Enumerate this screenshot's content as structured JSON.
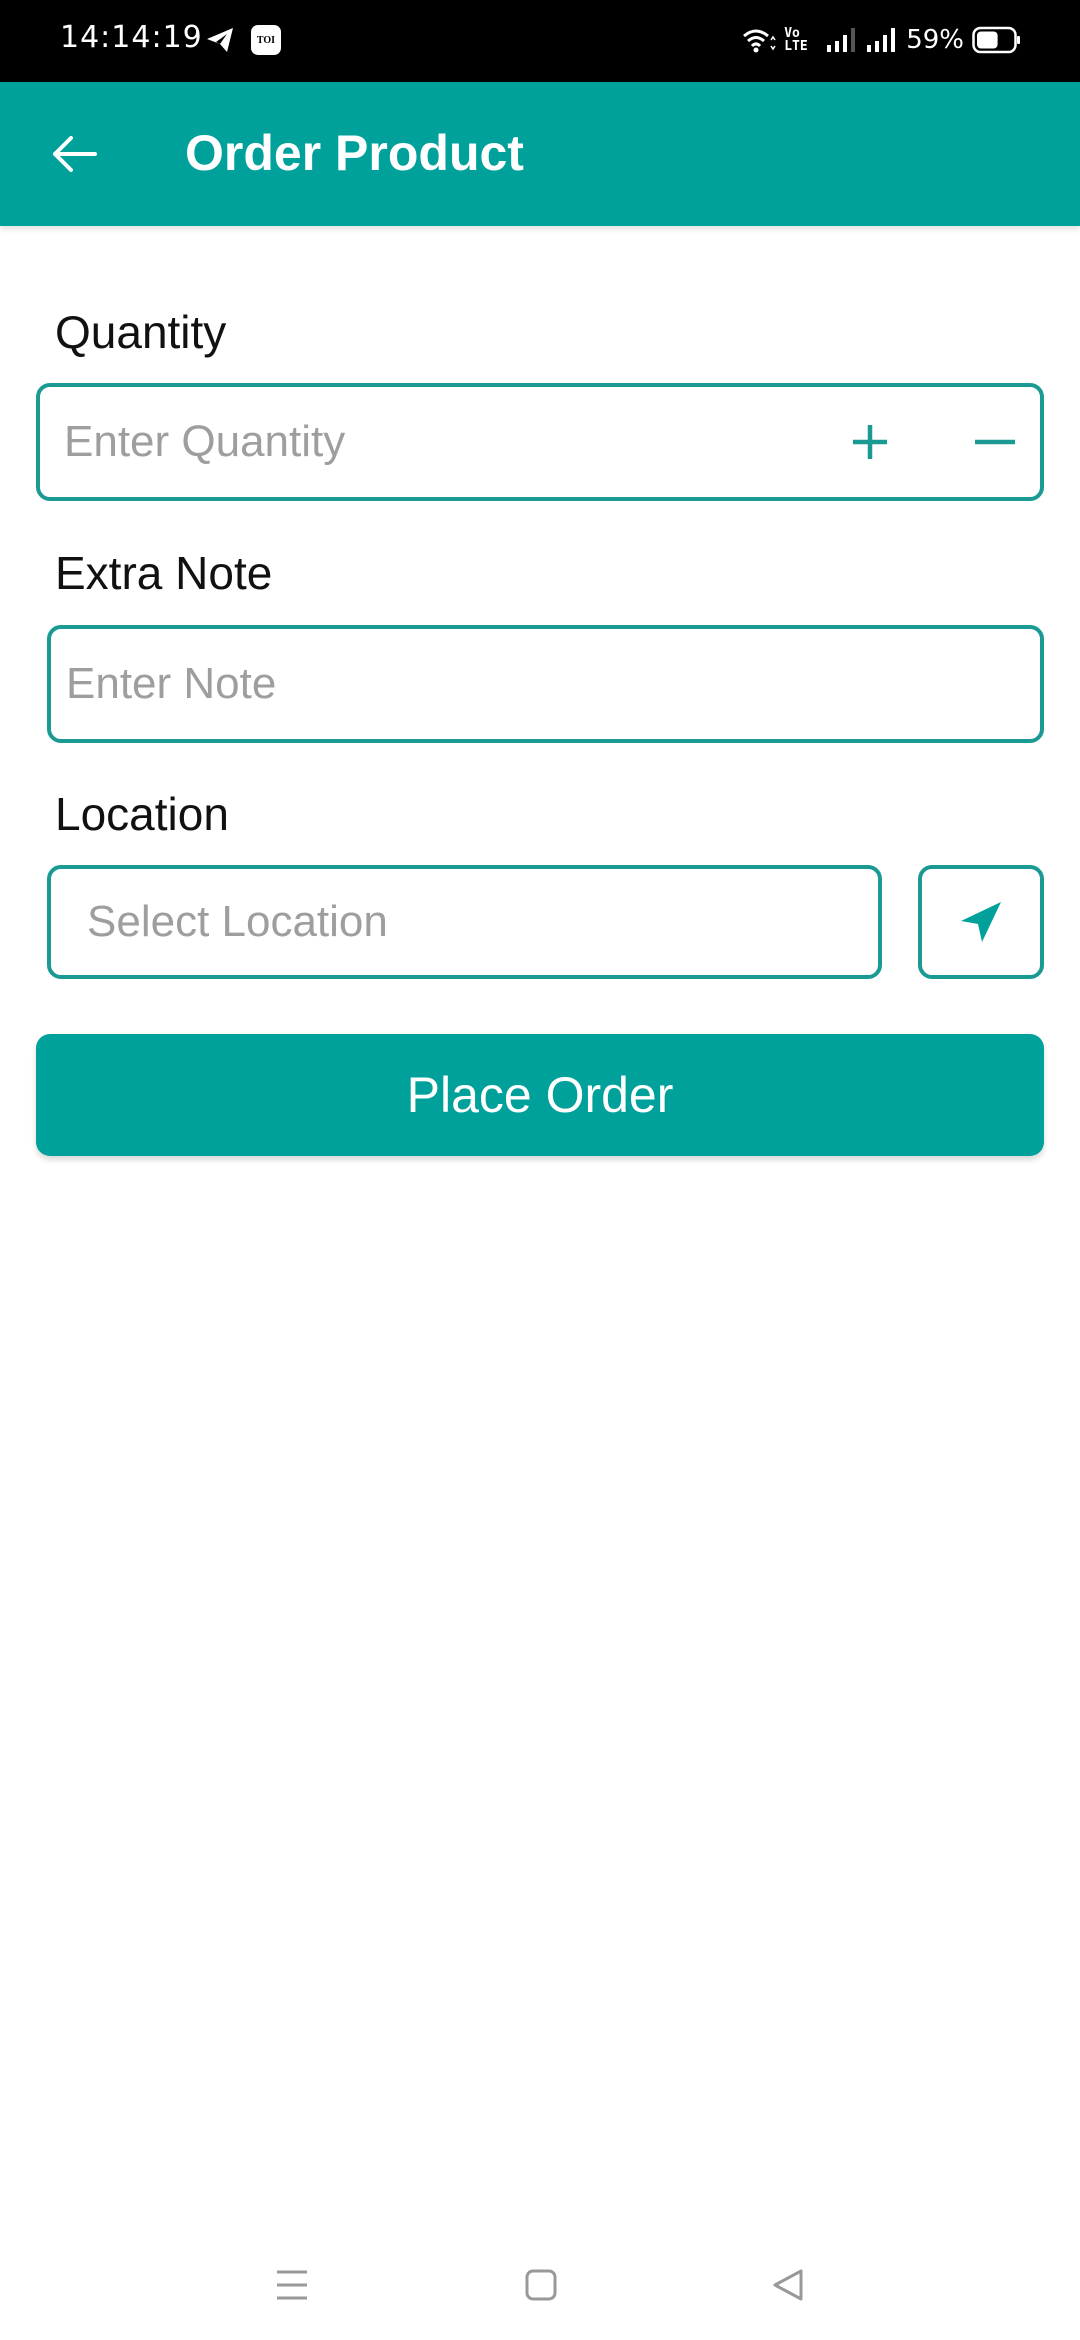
{
  "status_bar": {
    "time": "14:14:19",
    "notification_icons": [
      "telegram-icon",
      "toi-icon"
    ],
    "toi_label": "TOI",
    "volte_label_top": "Vo",
    "volte_label_bottom": "LTE",
    "battery_percent": "59%",
    "battery_level": 0.59
  },
  "app_bar": {
    "back_icon": "arrow-left-icon",
    "title": "Order Product"
  },
  "form": {
    "quantity": {
      "label": "Quantity",
      "value": "",
      "placeholder": "Enter Quantity",
      "increment_icon": "plus-icon",
      "decrement_icon": "minus-icon"
    },
    "extra_note": {
      "label": "Extra Note",
      "value": "",
      "placeholder": "Enter Note"
    },
    "location": {
      "label": "Location",
      "value": "",
      "placeholder": "Select Location",
      "locate_icon": "navigation-arrow-icon"
    },
    "submit_label": "Place Order"
  },
  "colors": {
    "primary": "#00A19A",
    "border": "#1A9A93",
    "placeholder": "#9E9E9E"
  },
  "nav_bar": {
    "items": [
      "menu-icon",
      "home-icon",
      "back-icon"
    ]
  }
}
